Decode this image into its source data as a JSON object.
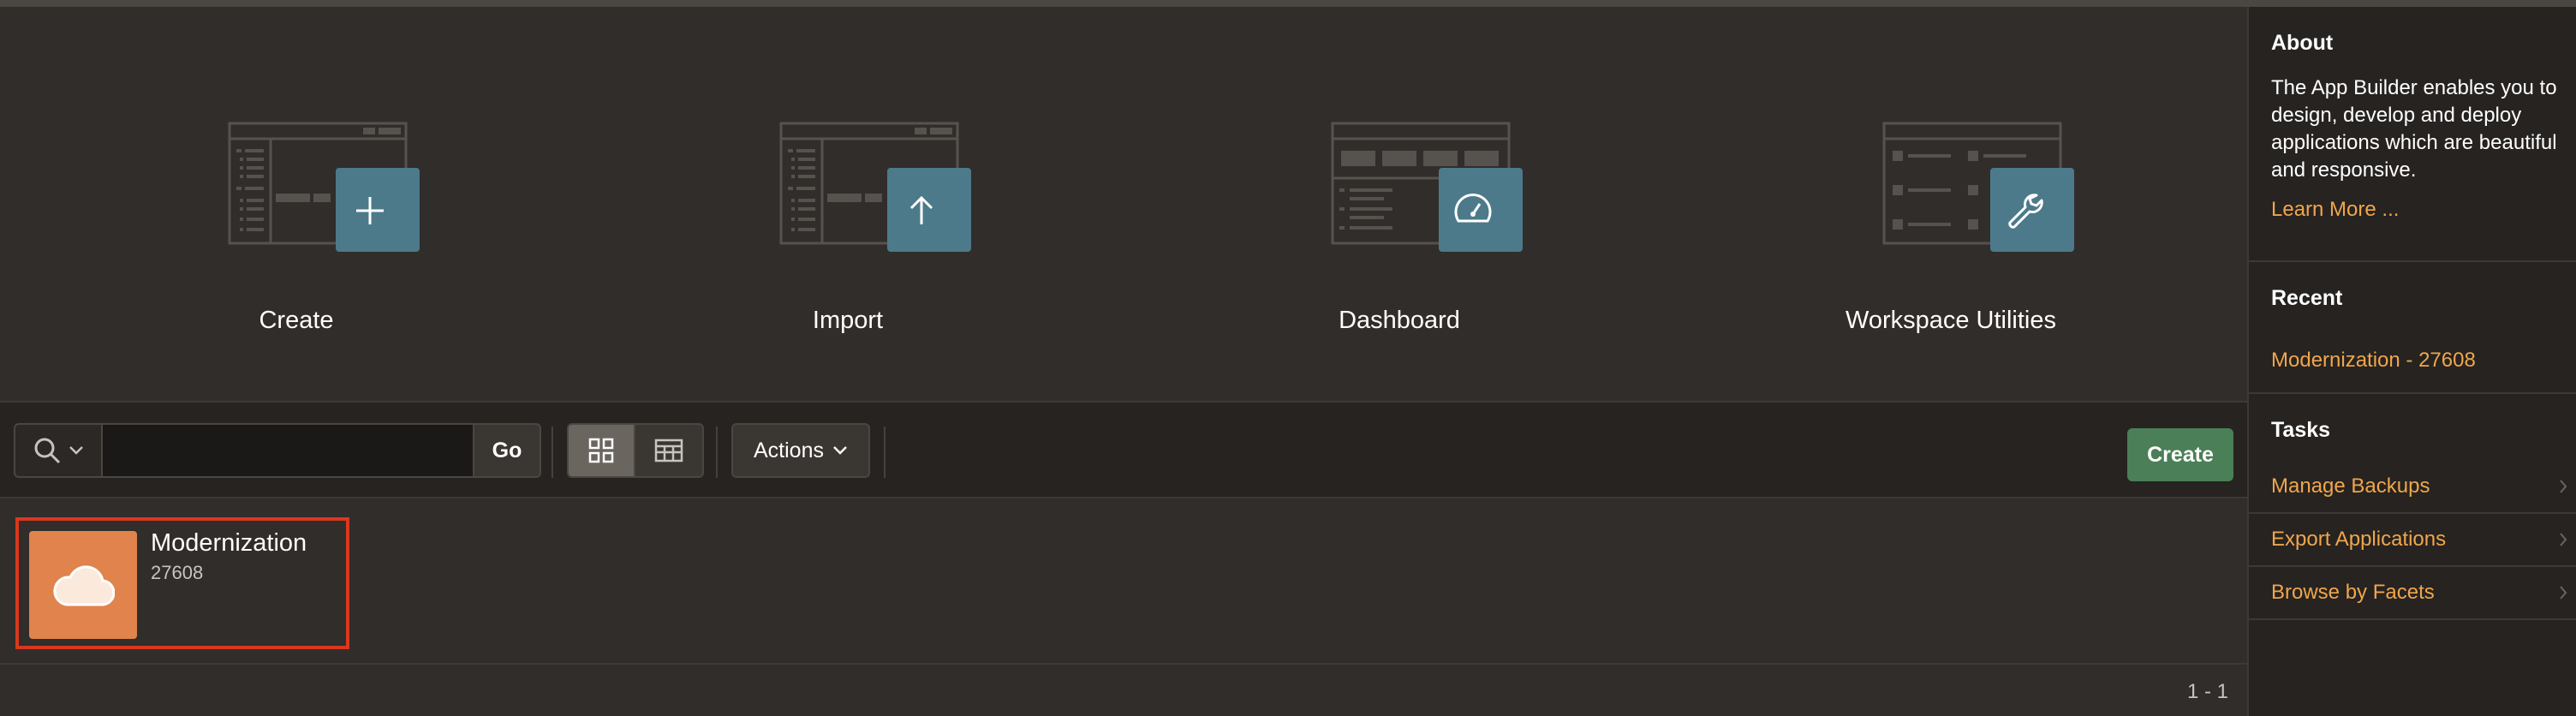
{
  "hero_tiles": [
    {
      "label": "Create",
      "icon": "plus-icon"
    },
    {
      "label": "Import",
      "icon": "arrow-up-icon"
    },
    {
      "label": "Dashboard",
      "icon": "gauge-icon"
    },
    {
      "label": "Workspace Utilities",
      "icon": "wrench-icon"
    }
  ],
  "toolbar": {
    "search_value": "",
    "go_label": "Go",
    "actions_label": "Actions",
    "create_label": "Create"
  },
  "apps": [
    {
      "name": "Modernization",
      "id": "27608",
      "icon": "cloud-icon"
    }
  ],
  "pagination": "1 - 1",
  "sidebar": {
    "about_title": "About",
    "about_text": "The App Builder enables you to design, develop and deploy applications which are beautiful and responsive.",
    "learn_more": "Learn More ...",
    "recent_title": "Recent",
    "recent_items": [
      "Modernization - 27608"
    ],
    "tasks_title": "Tasks",
    "tasks": [
      "Manage Backups",
      "Export Applications",
      "Browse by Facets"
    ]
  },
  "colors": {
    "background": "#312d2a",
    "sidebar_bg": "#262321",
    "tile_accent": "#4c7a8a",
    "create_button": "#4b7f57",
    "link": "#f0a64b",
    "app_icon": "#e0834c",
    "selection_border": "#d9381e"
  }
}
